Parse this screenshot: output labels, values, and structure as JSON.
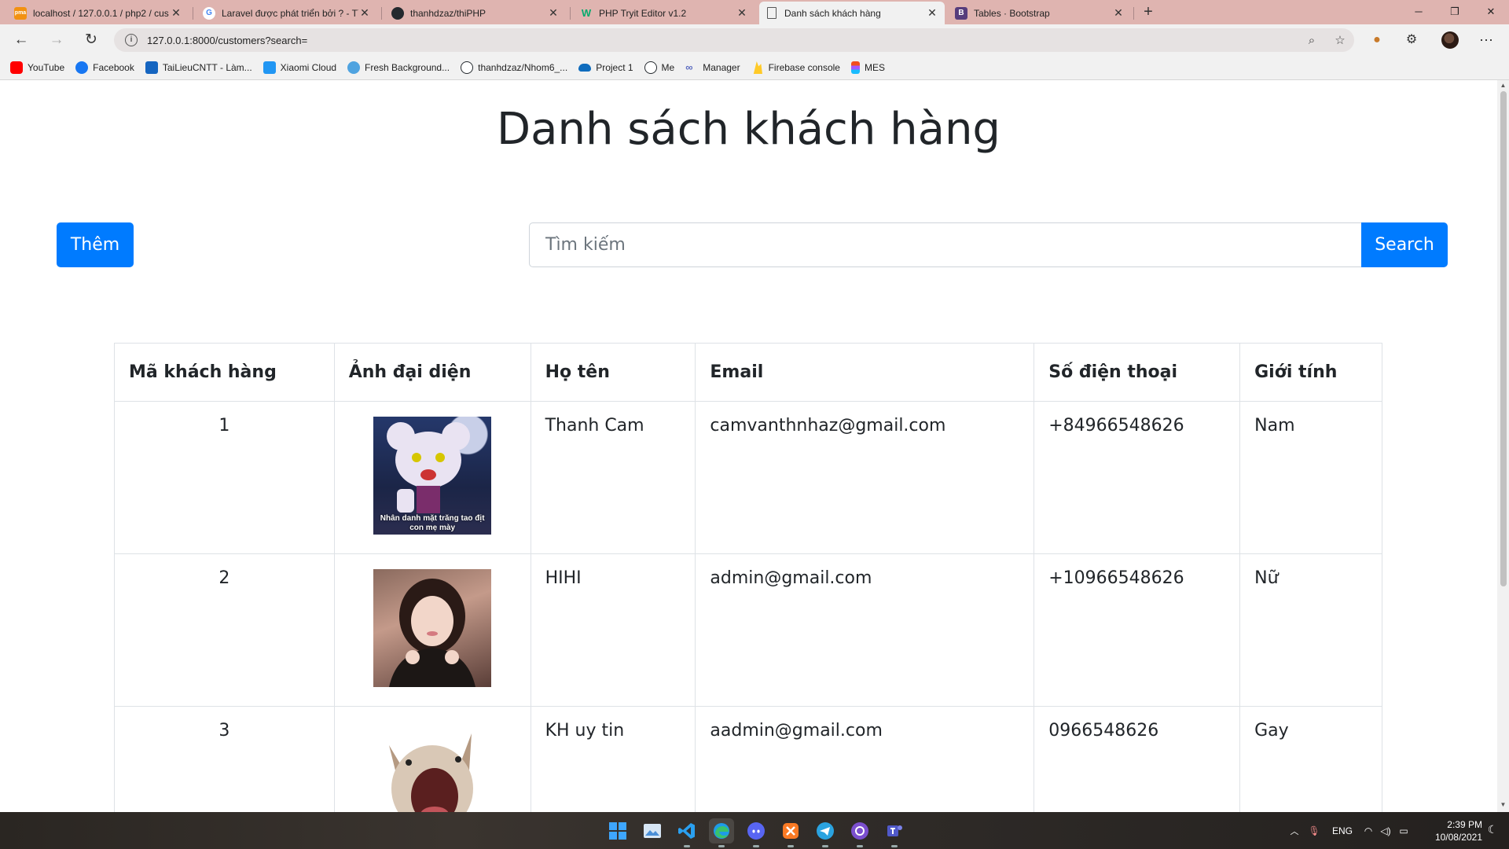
{
  "browser": {
    "tabs": [
      {
        "title": "localhost / 127.0.0.1 / php2 / cus",
        "favicon": "phpmyadmin-icon",
        "color": "#f29111",
        "glyph": "pma"
      },
      {
        "title": "Laravel được phát triển bởi ? - Tì",
        "favicon": "google-icon",
        "color": "#ffffff",
        "glyph": "G"
      },
      {
        "title": "thanhdzaz/thiPHP",
        "favicon": "github-icon",
        "color": "#24292e",
        "glyph": "●"
      },
      {
        "title": "PHP Tryit Editor v1.2",
        "favicon": "w3schools-icon",
        "color": "#04aa6d",
        "glyph": "W"
      },
      {
        "title": "Danh sách khách hàng",
        "favicon": "document-icon",
        "color": "#ffffff",
        "glyph": "▯"
      },
      {
        "title": "Tables · Bootstrap",
        "favicon": "bootstrap-icon",
        "color": "#563d7c",
        "glyph": "B"
      }
    ],
    "url": "127.0.0.1:8000/customers?search=",
    "bookmarks": [
      {
        "label": "YouTube",
        "color": "#ff0000"
      },
      {
        "label": "Facebook",
        "color": "#1877f2"
      },
      {
        "label": "TaiLieuCNTT - Làm...",
        "color": "#1565c0"
      },
      {
        "label": "Xiaomi Cloud",
        "color": "#2196f3"
      },
      {
        "label": "Fresh Background...",
        "color": "#4fa3e0"
      },
      {
        "label": "thanhdzaz/Nhom6_...",
        "color": "#24292e"
      },
      {
        "label": "Project 1",
        "color": "#0f6cbd"
      },
      {
        "label": "Me",
        "color": "#24292e"
      },
      {
        "label": "Manager",
        "color": "#5b6bc0"
      },
      {
        "label": "Firebase console",
        "color": "#ffca28"
      },
      {
        "label": "MES",
        "color": "#f24e1e"
      }
    ]
  },
  "page": {
    "title": "Danh sách khách hàng",
    "add_button": "Thêm",
    "search_placeholder": "Tìm kiếm",
    "search_value": "",
    "search_button": "Search",
    "accent_color": "#007bff",
    "table": {
      "headers": [
        "Mã khách hàng",
        "Ảnh đại diện",
        "Họ tên",
        "Email",
        "Số điện thoại",
        "Giới tính"
      ],
      "rows": [
        {
          "id": "1",
          "avatar": "cartoon-mouse-avatar",
          "avatar_caption": "Nhân danh mặt trăng tao địt con mẹ mày",
          "name": "Thanh Cam",
          "email": "camvanthnhaz@gmail.com",
          "phone": "+84966548626",
          "gender": "Nam"
        },
        {
          "id": "2",
          "avatar": "girl-photo-avatar",
          "avatar_caption": "",
          "name": "HIHI",
          "email": "admin@gmail.com",
          "phone": "+10966548626",
          "gender": "Nữ"
        },
        {
          "id": "3",
          "avatar": "cat-meme-avatar",
          "avatar_caption": "",
          "name": "KH uy tin",
          "email": "aadmin@gmail.com",
          "phone": "0966548626",
          "gender": "Gay"
        }
      ]
    }
  },
  "taskbar": {
    "apps": [
      "windows-start-icon",
      "photos-icon",
      "vscode-icon",
      "edge-icon",
      "discord-icon",
      "xampp-icon",
      "telegram-icon",
      "github-desktop-icon",
      "teams-icon"
    ],
    "language": "ENG",
    "time": "2:39 PM",
    "date": "10/08/2021"
  }
}
